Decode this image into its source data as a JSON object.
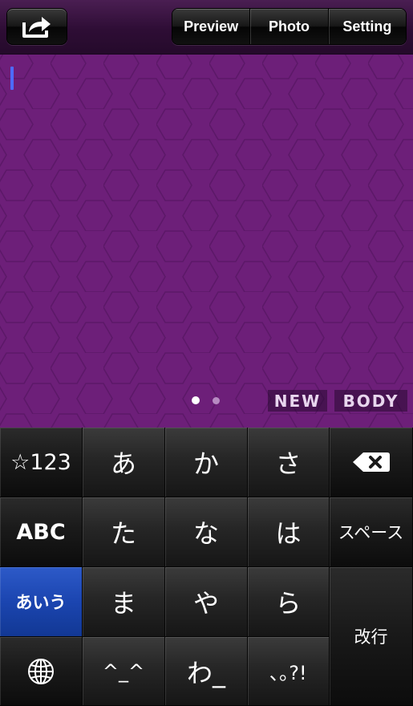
{
  "toolbar": {
    "share_icon": "share-arrow-icon",
    "segments": [
      "Preview",
      "Photo",
      "Setting"
    ]
  },
  "editor": {
    "background_color": "#6d1f79",
    "page_dots": {
      "count": 2,
      "current": 1
    },
    "tags": [
      "NEW",
      "BODY"
    ]
  },
  "keyboard": {
    "rows": [
      [
        "☆123",
        "あ",
        "か",
        "さ",
        "backspace-icon"
      ],
      [
        "ABC",
        "た",
        "な",
        "は",
        "スペース"
      ],
      [
        "あいう",
        "ま",
        "や",
        "ら",
        "改行"
      ],
      [
        "globe-icon",
        "^_^",
        "わ_",
        "､｡?!"
      ]
    ],
    "active_key": "あいう",
    "active_color": "#1b45b0"
  }
}
